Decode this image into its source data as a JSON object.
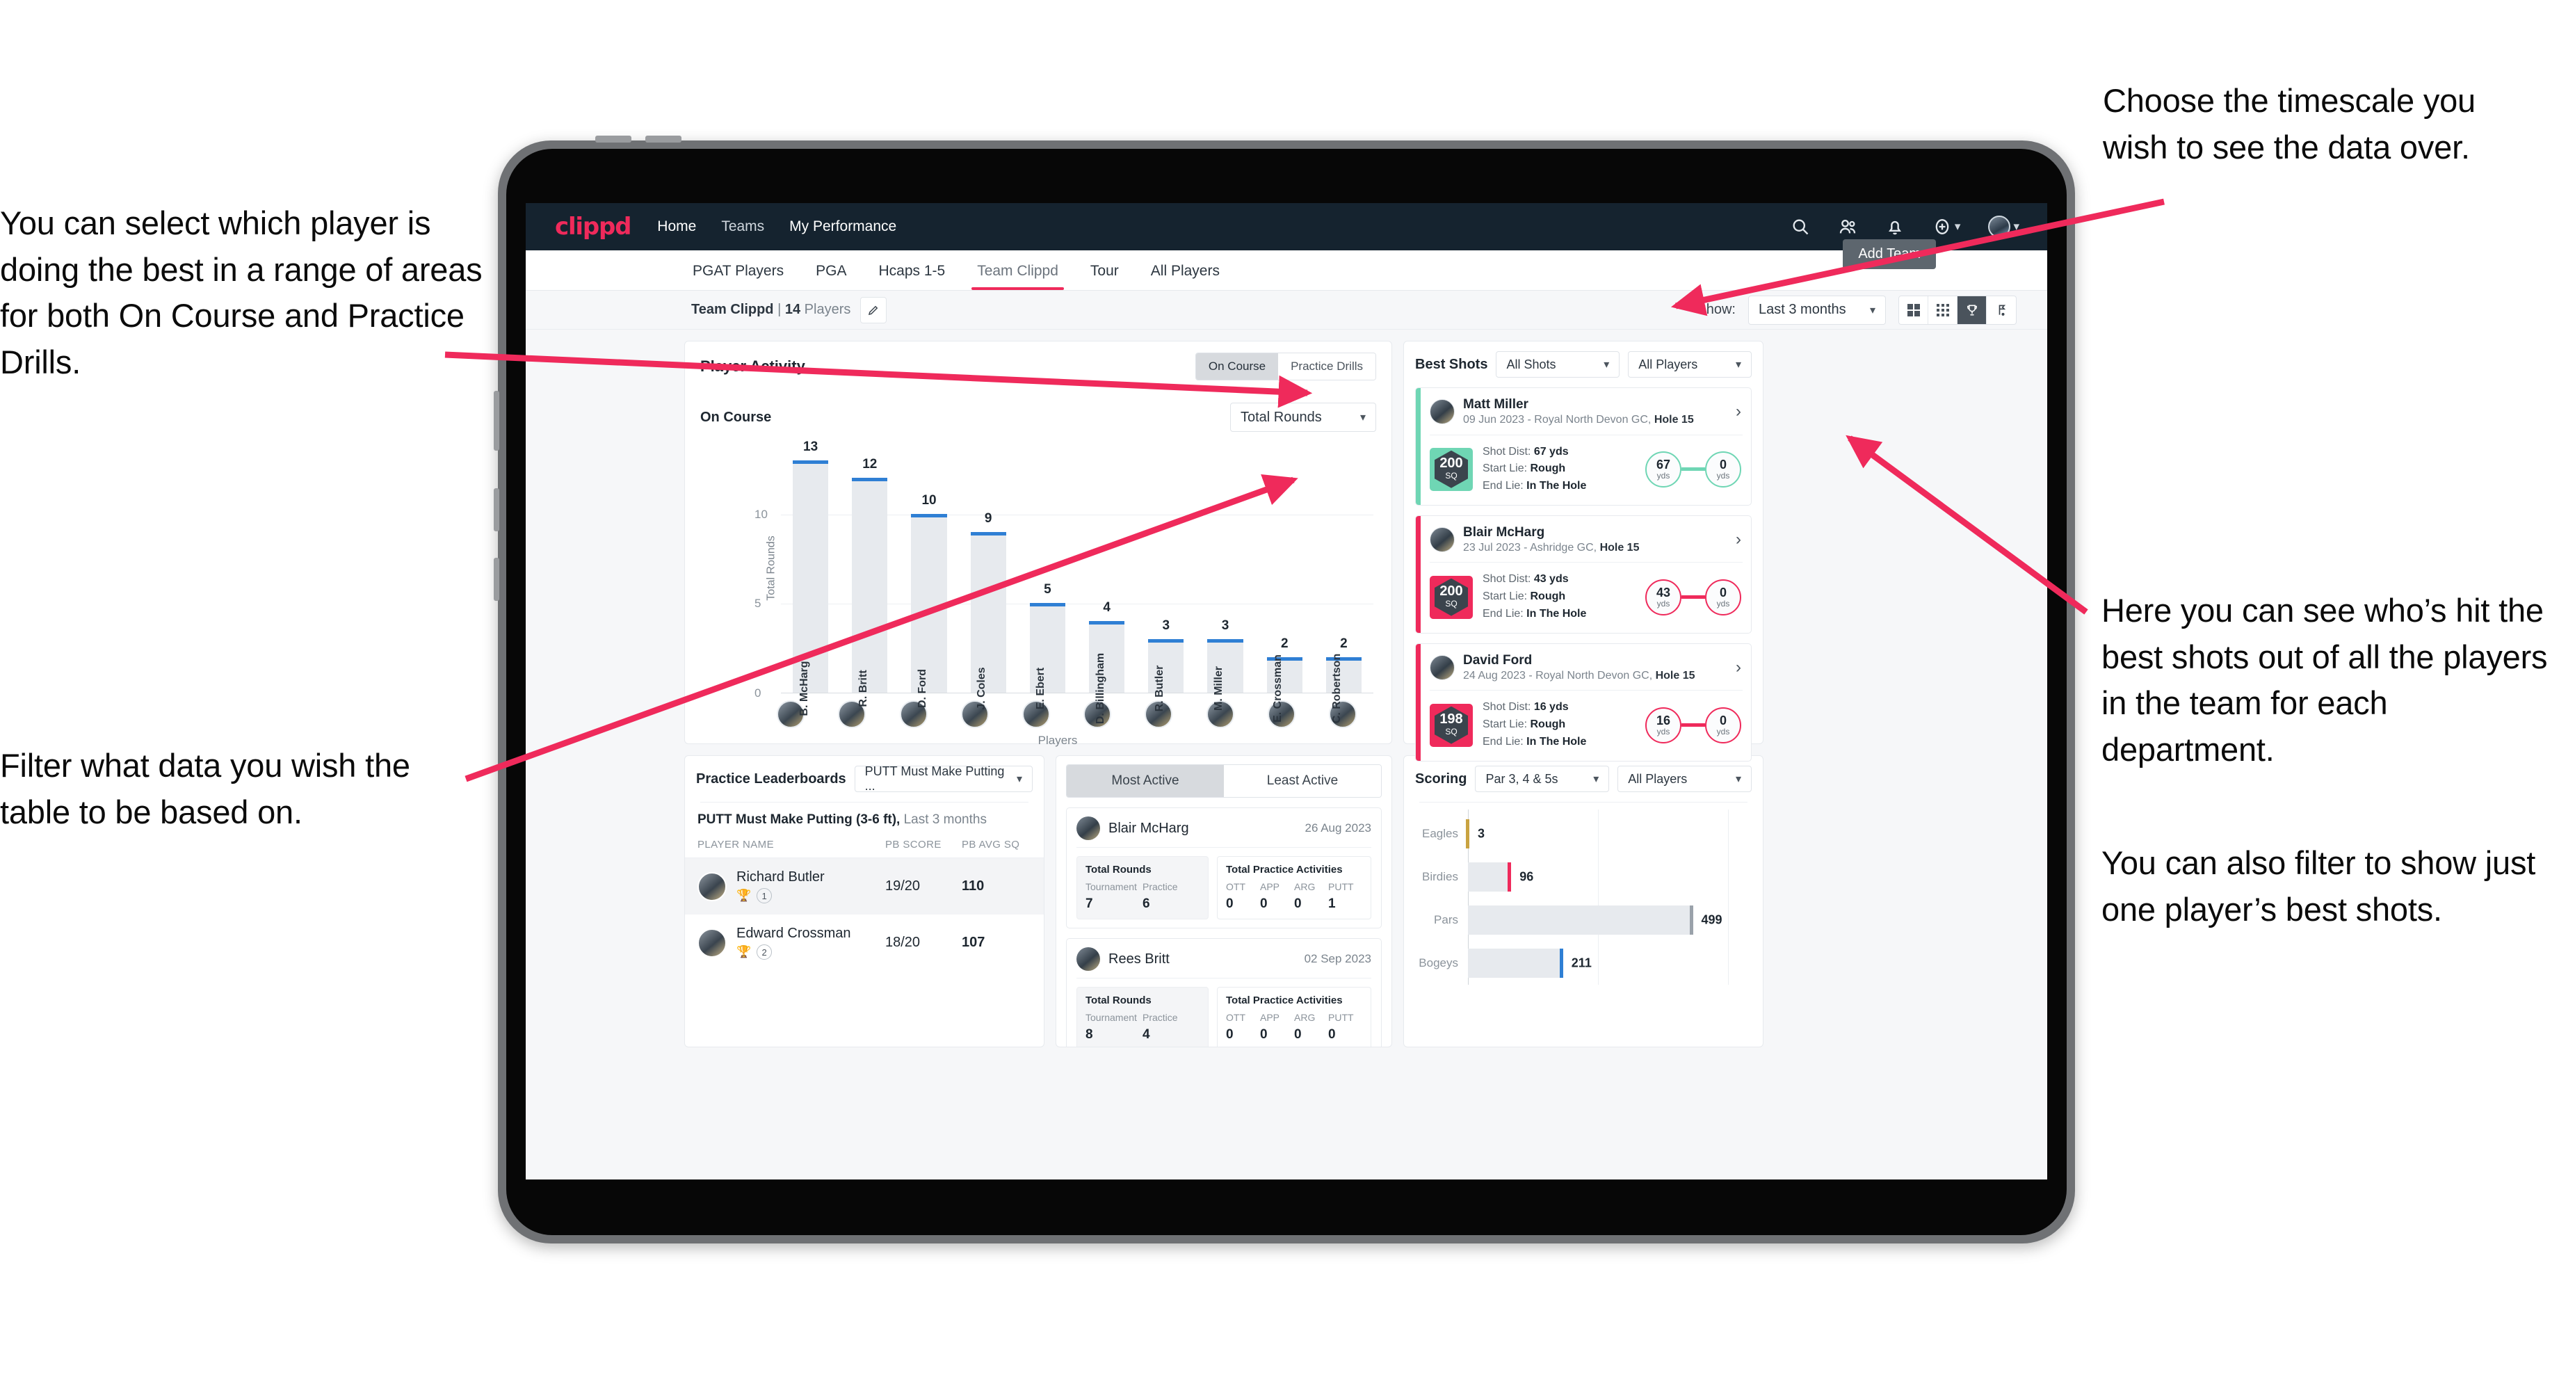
{
  "annotations": {
    "left_top": "You can select which player is doing the best in a range of areas for both On Course and Practice Drills.",
    "left_bottom": "Filter what data you wish the table to be based on.",
    "right_top": "Choose the timescale you wish to see the data over.",
    "right_middle": "Here you can see who’s hit the best shots out of all the players in the team for each department.",
    "right_bottom": "You can also filter to show just one player’s best shots."
  },
  "topbar": {
    "logo": "clippd",
    "links": [
      {
        "label": "Home",
        "active": true
      },
      {
        "label": "Teams",
        "active": false
      },
      {
        "label": "My Performance",
        "active": false
      }
    ],
    "icons": [
      "search-icon",
      "people-icon",
      "bell-icon",
      "plus-circle-icon",
      "avatar-icon"
    ]
  },
  "tabs": [
    {
      "label": "PGAT Players",
      "active": false
    },
    {
      "label": "PGA",
      "active": false
    },
    {
      "label": "Hcaps 1-5",
      "active": false
    },
    {
      "label": "Team Clippd",
      "active": true
    },
    {
      "label": "Tour",
      "active": false
    },
    {
      "label": "All Players",
      "active": false
    }
  ],
  "add_team_button": "Add Team",
  "subheader": {
    "team_name": "Team Clippd",
    "separator": "|",
    "player_count": "14",
    "players_word": "Players",
    "edit_icon": "pencil-icon",
    "show_label": "Show:",
    "timescale_value": "Last 3 months",
    "view_buttons": [
      "grid-large-icon",
      "grid-small-icon",
      "trophy-icon",
      "flag-icon"
    ],
    "active_view": "trophy-icon"
  },
  "player_activity": {
    "title": "Player Activity",
    "segments": [
      {
        "label": "On Course",
        "active": true
      },
      {
        "label": "Practice Drills",
        "active": false
      }
    ],
    "sub_title": "On Course",
    "metric_select": "Total Rounds",
    "chart_data": {
      "type": "bar",
      "title": "On Course",
      "xlabel": "Players",
      "ylabel": "Total Rounds",
      "ylim": [
        0,
        14
      ],
      "yticks": [
        0,
        5,
        10
      ],
      "grid": true,
      "categories": [
        "B. McHarg",
        "R. Britt",
        "D. Ford",
        "J. Coles",
        "E. Ebert",
        "D. Billingham",
        "R. Butler",
        "M. Miller",
        "E. Crossman",
        "C. Robertson"
      ],
      "values": [
        13,
        12,
        10,
        9,
        5,
        4,
        3,
        3,
        2,
        2
      ],
      "bar_color": "#e7eaee",
      "cap_color": "#2f7fd4"
    }
  },
  "best_shots": {
    "title": "Best Shots",
    "shot_filter": "All Shots",
    "player_filter": "All Players",
    "shots": [
      {
        "name": "Matt Miller",
        "meta_date": "09 Jun 2023 - Royal North Devon GC,",
        "meta_hole": "Hole 15",
        "sq": "200",
        "sq_unit": "SQ",
        "accent": "#6fd6b4",
        "shot_dist_label": "Shot Dist:",
        "shot_dist": "67 yds",
        "start_lie_label": "Start Lie:",
        "start_lie": "Rough",
        "end_lie_label": "End Lie:",
        "end_lie": "In The Hole",
        "from_value": "67",
        "from_unit": "yds",
        "to_value": "0",
        "to_unit": "yds"
      },
      {
        "name": "Blair McHarg",
        "meta_date": "23 Jul 2023 - Ashridge GC,",
        "meta_hole": "Hole 15",
        "sq": "200",
        "sq_unit": "SQ",
        "accent": "#ef2a5b",
        "shot_dist_label": "Shot Dist:",
        "shot_dist": "43 yds",
        "start_lie_label": "Start Lie:",
        "start_lie": "Rough",
        "end_lie_label": "End Lie:",
        "end_lie": "In The Hole",
        "from_value": "43",
        "from_unit": "yds",
        "to_value": "0",
        "to_unit": "yds"
      },
      {
        "name": "David Ford",
        "meta_date": "24 Aug 2023 - Royal North Devon GC,",
        "meta_hole": "Hole 15",
        "sq": "198",
        "sq_unit": "SQ",
        "accent": "#ef2a5b",
        "shot_dist_label": "Shot Dist:",
        "shot_dist": "16 yds",
        "start_lie_label": "Start Lie:",
        "start_lie": "Rough",
        "end_lie_label": "End Lie:",
        "end_lie": "In The Hole",
        "from_value": "16",
        "from_unit": "yds",
        "to_value": "0",
        "to_unit": "yds"
      }
    ]
  },
  "practice_leaderboards": {
    "title": "Practice Leaderboards",
    "drill_select": "PUTT Must Make Putting ...",
    "sub_bold": "PUTT Must Make Putting (3-6 ft),",
    "sub_light": "Last 3 months",
    "columns": [
      "PLAYER NAME",
      "PB SCORE",
      "PB AVG SQ"
    ],
    "rows": [
      {
        "name": "Richard Butler",
        "trophy": "gold",
        "rank": "1",
        "pb_score": "19/20",
        "pb_avg_sq": "110",
        "highlight": true
      },
      {
        "name": "Edward Crossman",
        "trophy": "silver",
        "rank": "2",
        "pb_score": "18/20",
        "pb_avg_sq": "107",
        "highlight": false
      }
    ]
  },
  "most_active": {
    "tabs": [
      {
        "label": "Most Active",
        "active": true
      },
      {
        "label": "Least Active",
        "active": false
      }
    ],
    "cards": [
      {
        "name": "Blair McHarg",
        "date": "26 Aug 2023",
        "rounds_title": "Total Rounds",
        "rounds_keys": [
          "Tournament",
          "Practice"
        ],
        "rounds_values": [
          "7",
          "6"
        ],
        "practice_title": "Total Practice Activities",
        "practice_keys": [
          "OTT",
          "APP",
          "ARG",
          "PUTT"
        ],
        "practice_values": [
          "0",
          "0",
          "0",
          "1"
        ]
      },
      {
        "name": "Rees Britt",
        "date": "02 Sep 2023",
        "rounds_title": "Total Rounds",
        "rounds_keys": [
          "Tournament",
          "Practice"
        ],
        "rounds_values": [
          "8",
          "4"
        ],
        "practice_title": "Total Practice Activities",
        "practice_keys": [
          "OTT",
          "APP",
          "ARG",
          "PUTT"
        ],
        "practice_values": [
          "0",
          "0",
          "0",
          "0"
        ]
      }
    ]
  },
  "scoring": {
    "title": "Scoring",
    "par_filter": "Par 3, 4 & 5s",
    "player_filter": "All Players",
    "chart_data": {
      "type": "bar",
      "orientation": "horizontal",
      "title": "Scoring",
      "categories": [
        "Eagles",
        "Birdies",
        "Pars",
        "Bogeys"
      ],
      "values": [
        3,
        96,
        499,
        211
      ],
      "colors": [
        "#c9a341",
        "#ef2a5b",
        "#9aa2aa",
        "#2f7fd4"
      ],
      "xlim": [
        0,
        620
      ],
      "grid": true
    }
  }
}
